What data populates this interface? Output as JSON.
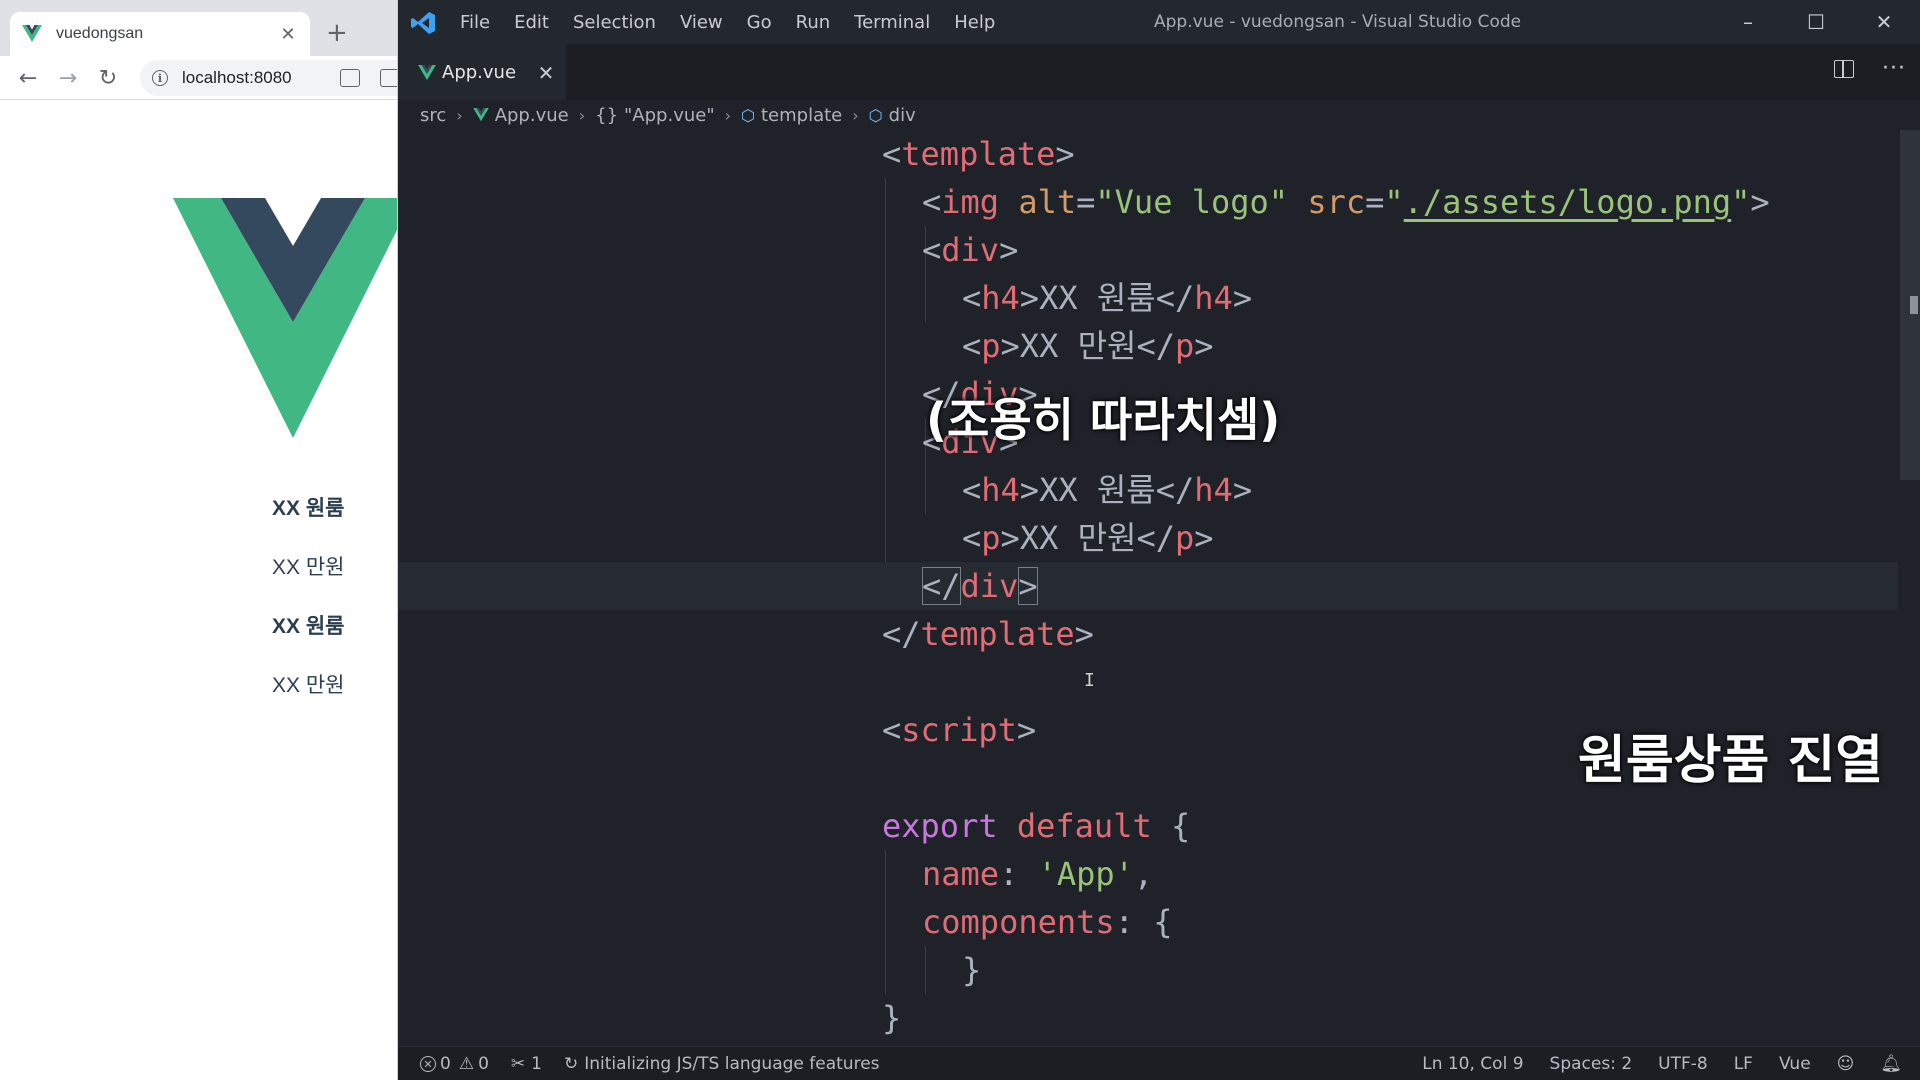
{
  "browser": {
    "tab_title": "vuedongsan",
    "tab_close": "✕",
    "new_tab": "+",
    "url": "localhost:8080",
    "brand_green": "#41b883",
    "brand_dark": "#34495e",
    "items": [
      {
        "title": "XX 원룸",
        "price": "XX 만원"
      },
      {
        "title": "XX 원룸",
        "price": "XX 만원"
      }
    ]
  },
  "vscode": {
    "menu": [
      "File",
      "Edit",
      "Selection",
      "View",
      "Go",
      "Run",
      "Terminal",
      "Help"
    ],
    "window_title": "App.vue - vuedongsan - Visual Studio Code",
    "tab_label": "App.vue",
    "tab_close": "✕",
    "breadcrumb": {
      "src": "src",
      "file": "App.vue",
      "braces": "{}",
      "quoted": "\"App.vue\"",
      "template": "template",
      "div": "div"
    },
    "code": {
      "l1": [
        "<",
        "template",
        ">"
      ],
      "l2": {
        "open": "<",
        "tag": "img",
        "attr1": "alt",
        "eq": "=",
        "val1": "\"Vue logo\"",
        "attr2": "src",
        "q": "\"",
        "val2": "./assets/logo.png",
        "close": ">"
      },
      "l3": [
        "<",
        "div",
        ">"
      ],
      "l4": {
        "a": "<",
        "tag": "h4",
        "b": ">",
        "text": "XX 원룸",
        "c": "</",
        "d": ">"
      },
      "l5": {
        "a": "<",
        "tag": "p",
        "b": ">",
        "text": "XX 만원",
        "c": "</",
        "d": ">"
      },
      "l6": [
        "</",
        "div",
        ">"
      ],
      "l7": [
        "<",
        "div",
        ">"
      ],
      "l8": {
        "a": "<",
        "tag": "h4",
        "b": ">",
        "text": "XX 원룸",
        "c": "</",
        "d": ">"
      },
      "l9": {
        "a": "<",
        "tag": "p",
        "b": ">",
        "text": "XX 만원",
        "c": "</",
        "d": ">"
      },
      "l10": [
        "</",
        "div",
        ">"
      ],
      "l11": [
        "</",
        "template",
        ">"
      ],
      "l13": [
        "<",
        "script",
        ">"
      ],
      "l15": {
        "kw1": "export",
        "kw2": "default",
        "brace": "{"
      },
      "l16": {
        "prop": "name",
        "colon": ":",
        "val": "'App'",
        "comma": ","
      },
      "l17": {
        "prop": "components",
        "colon": ":",
        "brace": "{"
      },
      "l18": "}",
      "l19": "}"
    },
    "overlay_caption": "(조용히 따라치셈)",
    "overlay_title": "원룸상품 진열",
    "status": {
      "errors": "0",
      "warnings": "0",
      "ports": "1",
      "activity": "Initializing JS/TS language features",
      "position": "Ln 10, Col 9",
      "spaces": "Spaces: 2",
      "encoding": "UTF-8",
      "eol": "LF",
      "language": "Vue"
    }
  }
}
